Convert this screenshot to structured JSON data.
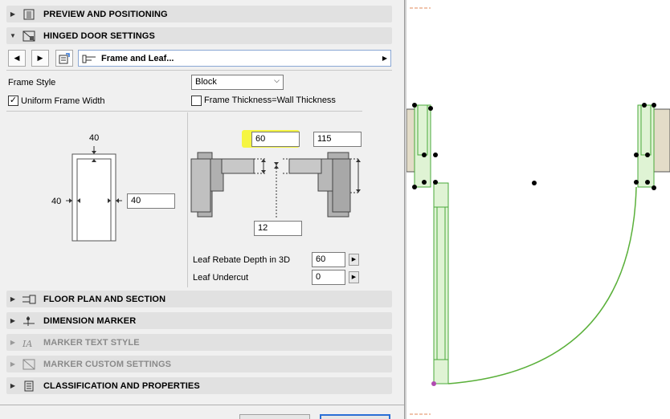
{
  "sections": {
    "preview": "PREVIEW AND POSITIONING",
    "hinged": "HINGED DOOR SETTINGS",
    "floor_plan": "FLOOR PLAN AND SECTION",
    "dimension": "DIMENSION MARKER",
    "marker_text": "MARKER TEXT STYLE",
    "marker_custom": "MARKER CUSTOM SETTINGS",
    "classification": "CLASSIFICATION AND PROPERTIES"
  },
  "page_select": {
    "label": "Frame and Leaf..."
  },
  "frame_style": {
    "label": "Frame Style",
    "value": "Block"
  },
  "uniform_frame_width": {
    "label": "Uniform Frame Width",
    "checked": true
  },
  "frame_thickness": {
    "label": "Frame Thickness=Wall Thickness",
    "checked": false
  },
  "frame_diagram": {
    "top_width": "40",
    "left_width": "40",
    "right_width_value": "40"
  },
  "leaf_diagram": {
    "rebate_width_value": "60",
    "frame_depth_value": "115",
    "gap_value": "12"
  },
  "leaf_rebate_depth": {
    "label": "Leaf Rebate Depth in 3D",
    "value": "60"
  },
  "leaf_undercut": {
    "label": "Leaf Undercut",
    "value": "0"
  },
  "colors": {
    "highlight": "#f5f542",
    "accent": "#2a6fd6",
    "door_green": "#6cc04a"
  }
}
